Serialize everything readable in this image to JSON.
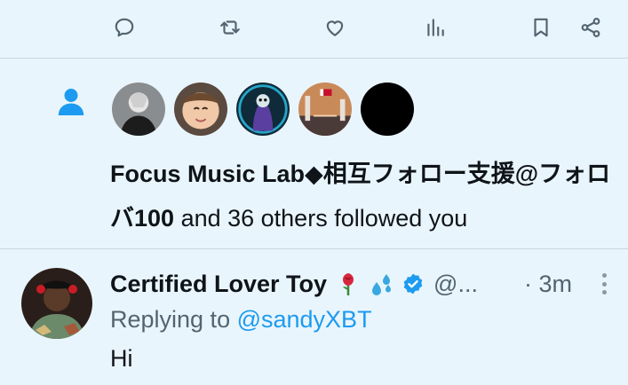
{
  "action_bar": {
    "icons": [
      "reply-icon",
      "retweet-icon",
      "like-icon",
      "views-icon",
      "bookmark-icon",
      "share-icon"
    ]
  },
  "follow_notification": {
    "icon": "person-icon",
    "avatar_count": 5,
    "names": "Focus Music Lab◆相互フォロー支援@フォロバ100",
    "rest": " and 36 others followed you"
  },
  "tweet": {
    "author_name": "Certified Lover Toy",
    "emojis": [
      "rose-emoji",
      "sweat-droplets-emoji"
    ],
    "verified_badge": "verified-badge-icon",
    "handle": "@...",
    "timestamp": "· 3m",
    "replying_prefix": "Replying to ",
    "replying_to": "@sandyXBT",
    "text": "Hi"
  },
  "colors": {
    "background": "#e9f5fc",
    "accent": "#1d9bf0",
    "secondary_text": "#536471",
    "primary_text": "#0f1419"
  }
}
